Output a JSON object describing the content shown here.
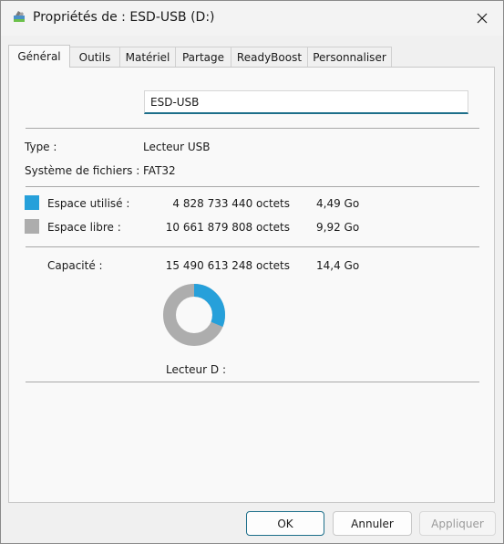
{
  "window": {
    "title": "Propriétés de : ESD-USB (D:)",
    "close_glyph": "✕",
    "title_icon": "usb-drive-icon"
  },
  "tabs": [
    {
      "label": "Général",
      "active": true
    },
    {
      "label": "Outils"
    },
    {
      "label": "Matériel"
    },
    {
      "label": "Partage"
    },
    {
      "label": "ReadyBoost"
    },
    {
      "label": "Personnaliser"
    }
  ],
  "general": {
    "volume_name": "ESD-USB",
    "type_label": "Type :",
    "type_value": "Lecteur USB",
    "fs_label": "Système de fichiers :",
    "fs_value": "FAT32",
    "used_label": "Espace utilisé :",
    "used_bytes": "4 828 733 440 octets",
    "used_size": "4,49 Go",
    "free_label": "Espace libre :",
    "free_bytes": "10 661 879 808 octets",
    "free_size": "9,92 Go",
    "capacity_label": "Capacité :",
    "capacity_bytes": "15 490 613 248 octets",
    "capacity_size": "14,4 Go",
    "drive_label": "Lecteur D :",
    "used_fraction": 0.3117
  },
  "colors": {
    "used": "#26a0da",
    "free": "#adadad",
    "accent": "#1d6f8a"
  },
  "buttons": {
    "ok": "OK",
    "cancel": "Annuler",
    "apply": "Appliquer"
  }
}
